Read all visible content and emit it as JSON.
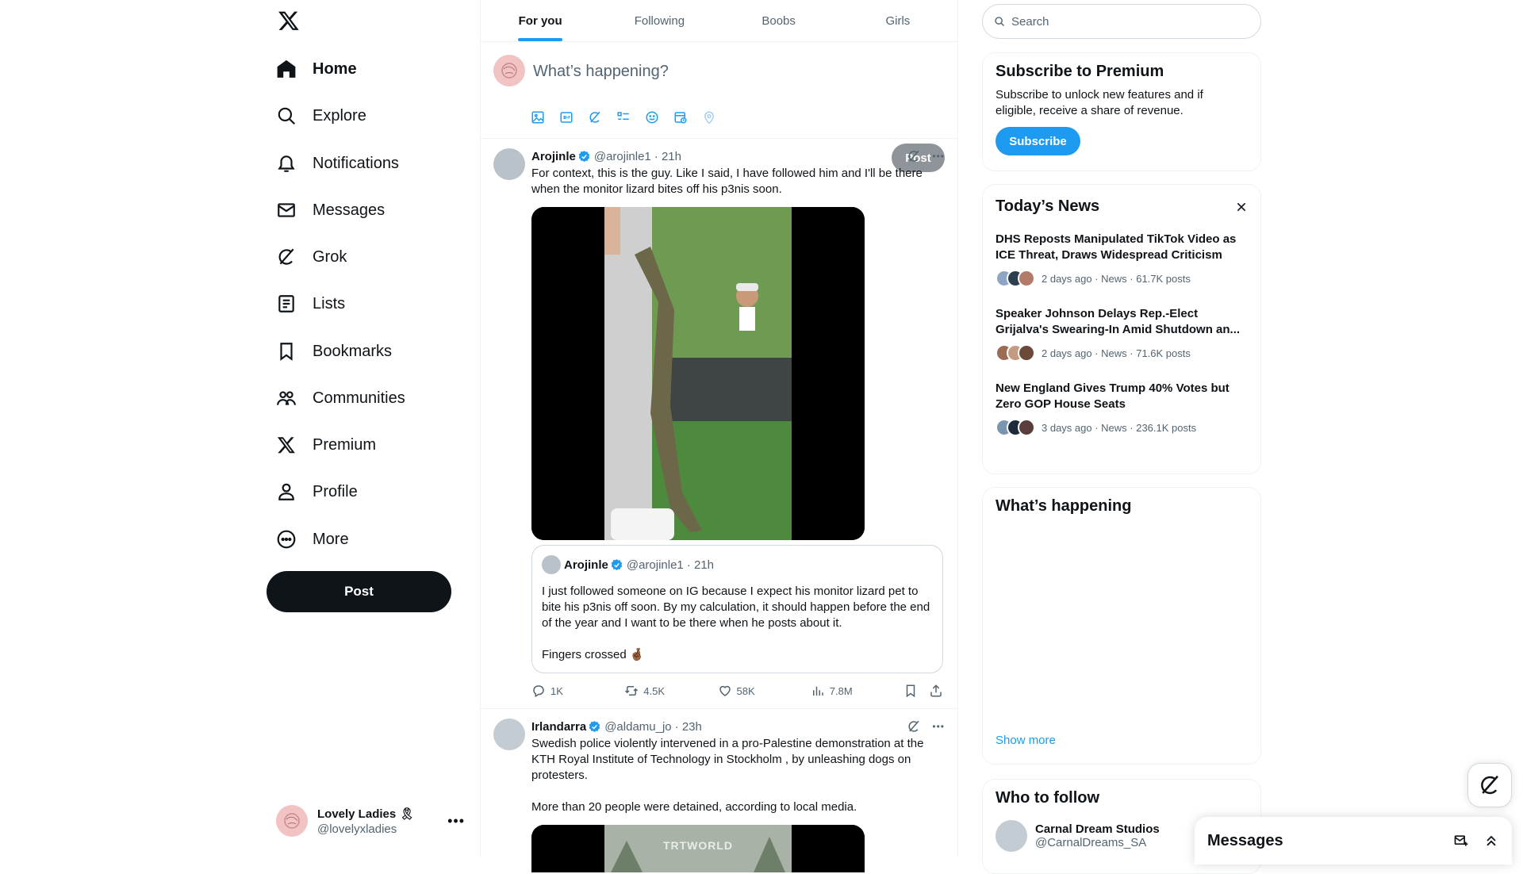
{
  "nav": {
    "items": [
      {
        "label": "Home",
        "icon": "home-icon"
      },
      {
        "label": "Explore",
        "icon": "search-icon"
      },
      {
        "label": "Notifications",
        "icon": "bell-icon"
      },
      {
        "label": "Messages",
        "icon": "envelope-icon"
      },
      {
        "label": "Grok",
        "icon": "grok-icon"
      },
      {
        "label": "Lists",
        "icon": "list-icon"
      },
      {
        "label": "Bookmarks",
        "icon": "bookmark-icon"
      },
      {
        "label": "Communities",
        "icon": "people-icon"
      },
      {
        "label": "Premium",
        "icon": "x-logo-icon"
      },
      {
        "label": "Profile",
        "icon": "person-icon"
      },
      {
        "label": "More",
        "icon": "more-circle-icon"
      }
    ],
    "post_label": "Post",
    "account": {
      "name": "Lovely Ladies",
      "handle": "@lovelyxladies",
      "badge": "🎗"
    }
  },
  "tabs": [
    "For you",
    "Following",
    "Boobs",
    "Girls"
  ],
  "compose": {
    "placeholder": "What’s happening?",
    "post_label": "Post"
  },
  "tweets": [
    {
      "name": "Arojinle",
      "handle": "@arojinle1",
      "time": "· 21h",
      "text": "For context, this is the guy. Like I said, I have followed him and I'll be there when the monitor lizard bites off his p3nis soon.",
      "quote": {
        "name": "Arojinle",
        "handle": "@arojinle1",
        "time": "· 21h",
        "text1": "I just followed someone on IG because I expect his monitor lizard pet to bite his p3nis off soon. By my calculation, it should happen before the end of the year and I want to be there when he posts about it.",
        "text2": "Fingers crossed 🤞🏾"
      },
      "replies": "1K",
      "reposts": "4.5K",
      "likes": "58K",
      "views": "7.8M"
    },
    {
      "name": "Irlandarra",
      "handle": "@aldamu_jo",
      "time": "· 23h",
      "text1": "Swedish police violently intervened in a pro-Palestine demonstration at the KTH Royal Institute of Technology in Stockholm , by unleashing dogs on protesters.",
      "text2": "More than 20 people were detained, according to local media.",
      "watermark": "TRTWORLD"
    }
  ],
  "right": {
    "search_placeholder": "Search",
    "premium": {
      "title": "Subscribe to Premium",
      "text": "Subscribe to unlock new features and if eligible, receive a share of revenue.",
      "button": "Subscribe"
    },
    "news_title": "Today’s News",
    "news": [
      {
        "title": "DHS Reposts Manipulated TikTok Video as ICE Threat, Draws Widespread Criticism",
        "meta": "2 days ago · News · 61.7K posts"
      },
      {
        "title": "Speaker Johnson Delays Rep.-Elect Grijalva's Swearing-In Amid Shutdown an...",
        "meta": "2 days ago · News · 71.6K posts"
      },
      {
        "title": "New England Gives Trump 40% Votes but Zero GOP House Seats",
        "meta": "3 days ago · News · 236.1K posts"
      }
    ],
    "happening_title": "What’s happening",
    "show_more": "Show more",
    "follow_title": "Who to follow",
    "follow": {
      "name": "Carnal Dream Studios",
      "handle": "@CarnalDreams_SA"
    },
    "messages_title": "Messages"
  },
  "colors": {
    "accent": "#1d9bf0",
    "text": "#0f1419",
    "muted": "#536471"
  }
}
